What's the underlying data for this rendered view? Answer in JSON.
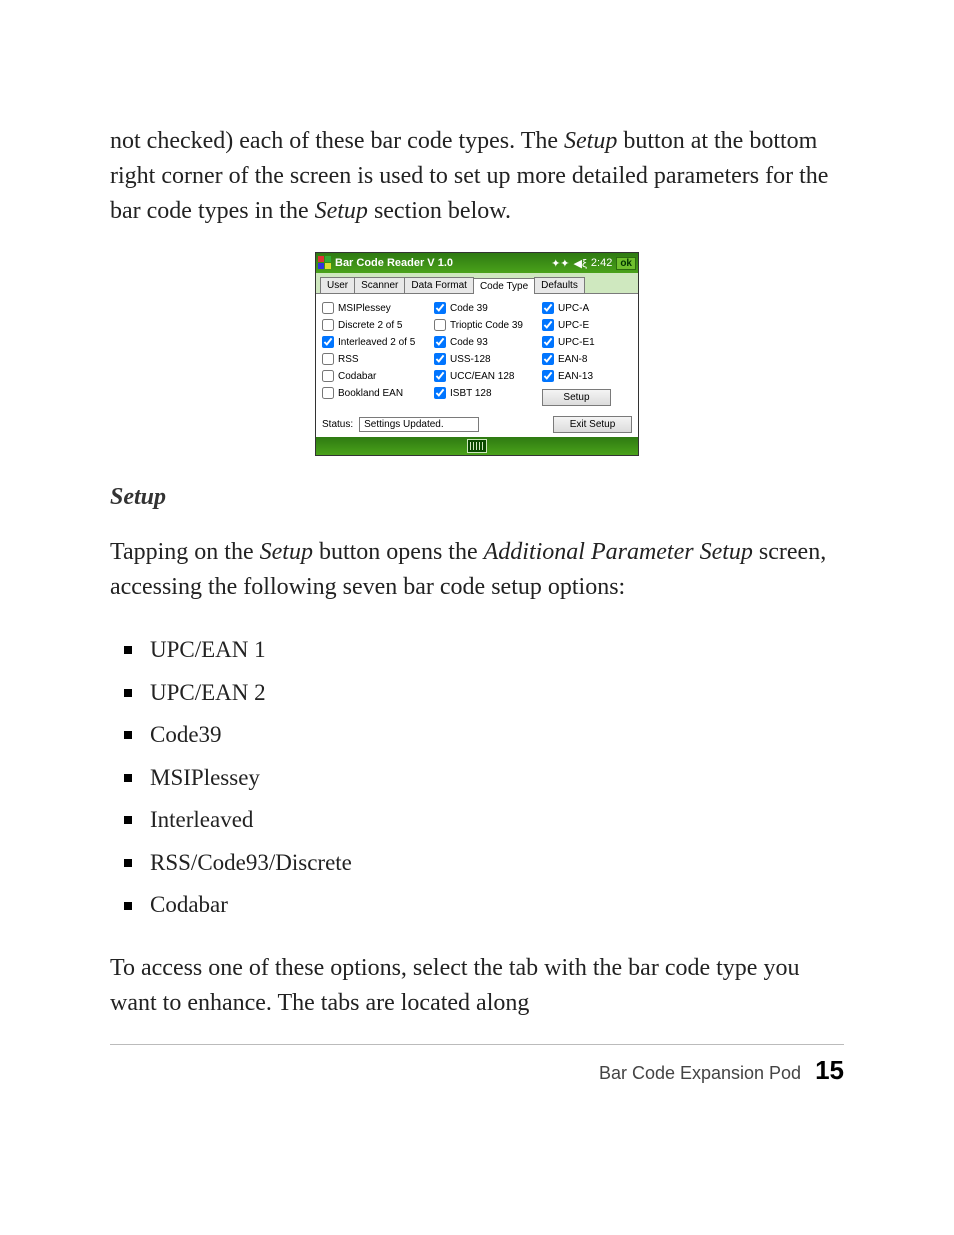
{
  "para1_pre": "not checked) each of these bar code types. The ",
  "para1_em1": "Setup",
  "para1_mid": " button at the bottom right corner of the screen is used to set up more detailed parameters for the bar code types in the ",
  "para1_em2": "Setup",
  "para1_post": " section below.",
  "app": {
    "title": "Bar Code Reader V 1.0",
    "time": "2:42",
    "ok": "ok",
    "tabs": [
      "User",
      "Scanner",
      "Data Format",
      "Code Type",
      "Defaults"
    ],
    "col1": [
      {
        "label": "MSIPlessey",
        "checked": false
      },
      {
        "label": "Discrete 2 of 5",
        "checked": false
      },
      {
        "label": "Interleaved 2 of 5",
        "checked": true
      },
      {
        "label": "RSS",
        "checked": false
      },
      {
        "label": "Codabar",
        "checked": false
      },
      {
        "label": "Bookland EAN",
        "checked": false
      }
    ],
    "col2": [
      {
        "label": "Code 39",
        "checked": true
      },
      {
        "label": "Trioptic Code 39",
        "checked": false
      },
      {
        "label": "Code 93",
        "checked": true
      },
      {
        "label": "USS-128",
        "checked": true
      },
      {
        "label": "UCC/EAN 128",
        "checked": true
      },
      {
        "label": "ISBT 128",
        "checked": true
      }
    ],
    "col3": [
      {
        "label": "UPC-A",
        "checked": true
      },
      {
        "label": "UPC-E",
        "checked": true
      },
      {
        "label": "UPC-E1",
        "checked": true
      },
      {
        "label": "EAN-8",
        "checked": true
      },
      {
        "label": "EAN-13",
        "checked": true
      }
    ],
    "setup_btn": "Setup",
    "status_label": "Status:",
    "status_value": "Settings Updated.",
    "exit_btn": "Exit Setup"
  },
  "section_head": "Setup",
  "para2_pre": "Tapping on the ",
  "para2_em1": "Setup",
  "para2_mid": " button opens the ",
  "para2_em2": "Additional Parameter Setup",
  "para2_post": " screen, accessing the following seven bar code setup options:",
  "bullets": [
    "UPC/EAN 1",
    "UPC/EAN 2",
    "Code39",
    "MSIPlessey",
    "Interleaved",
    "RSS/Code93/Discrete",
    "Codabar"
  ],
  "para3": "To access one of these options, select the tab with the bar code type you want to enhance. The tabs are located along",
  "footer_title": "Bar Code Expansion Pod",
  "footer_page": "15"
}
